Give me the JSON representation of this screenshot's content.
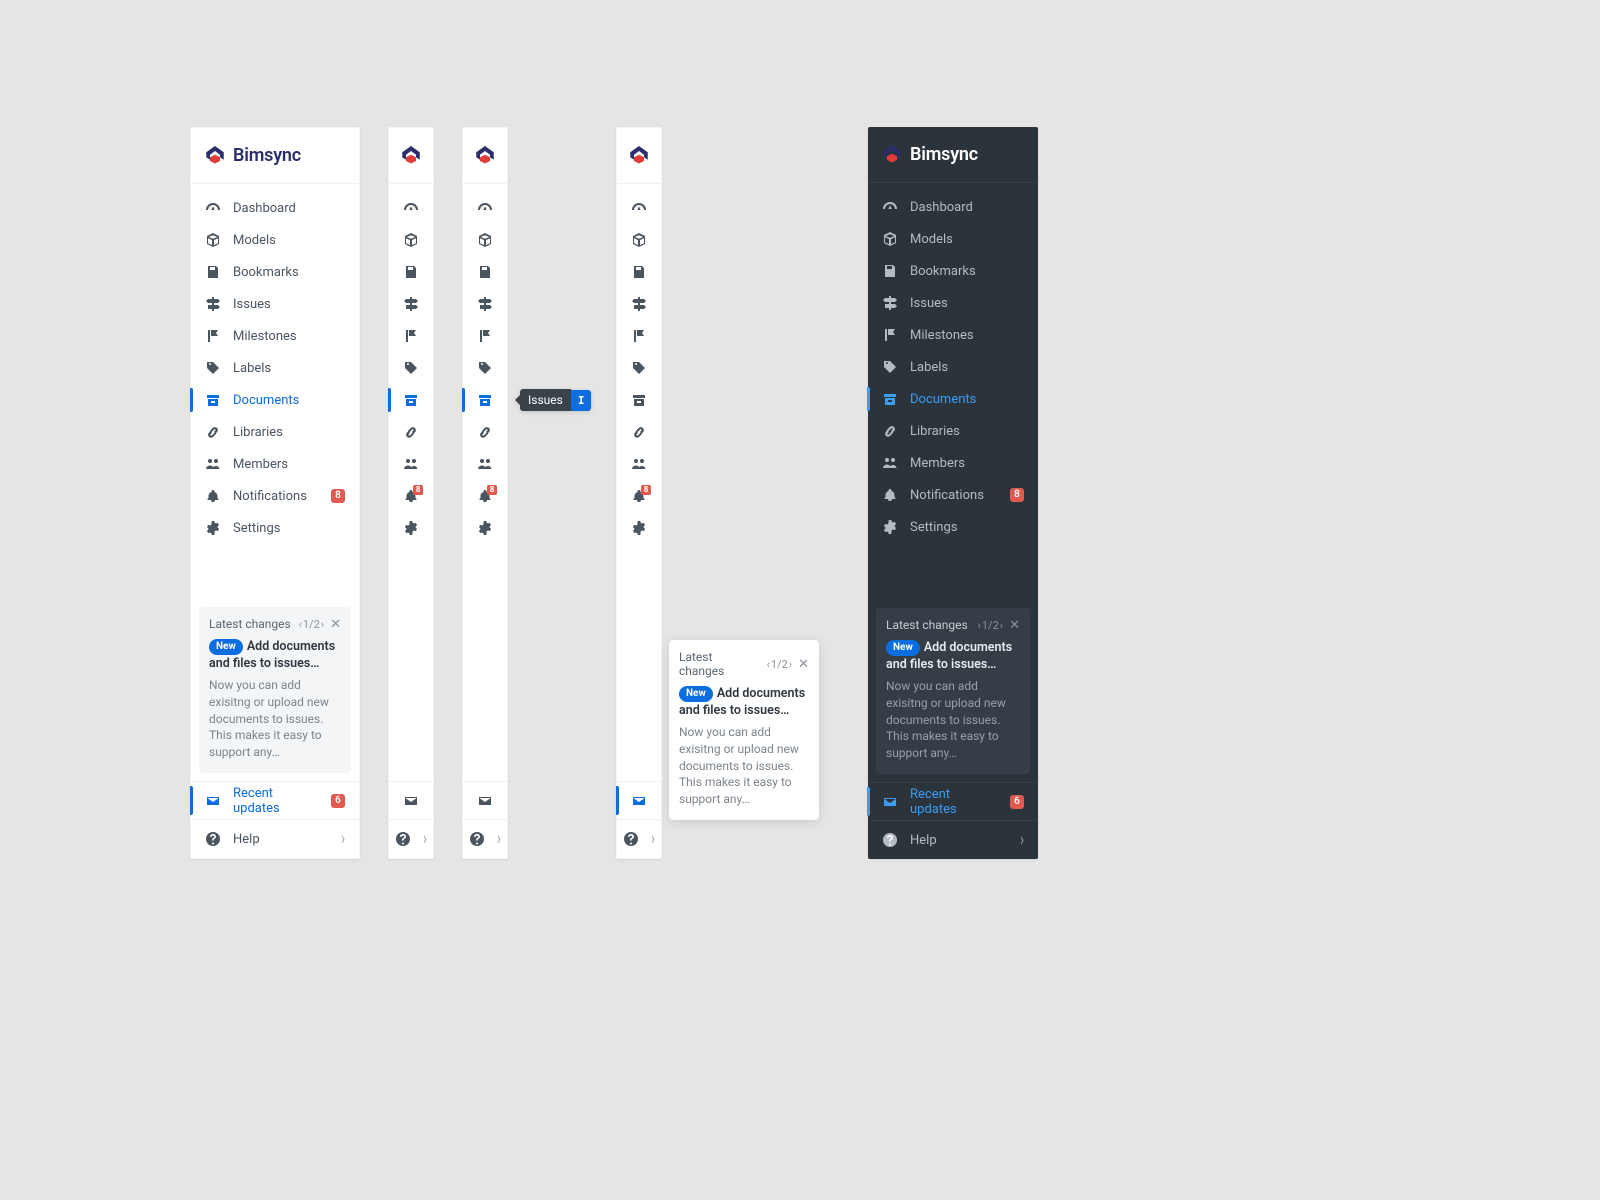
{
  "brand": {
    "name": "Bimsync"
  },
  "nav": {
    "items": [
      {
        "key": "dashboard",
        "label": "Dashboard",
        "icon": "gauge-icon"
      },
      {
        "key": "models",
        "label": "Models",
        "icon": "cube-icon"
      },
      {
        "key": "bookmarks",
        "label": "Bookmarks",
        "icon": "save-icon"
      },
      {
        "key": "issues",
        "label": "Issues",
        "icon": "signpost-icon"
      },
      {
        "key": "milestones",
        "label": "Milestones",
        "icon": "flag-icon"
      },
      {
        "key": "labels",
        "label": "Labels",
        "icon": "tag-icon"
      },
      {
        "key": "documents",
        "label": "Documents",
        "icon": "archive-icon",
        "active": true
      },
      {
        "key": "libraries",
        "label": "Libraries",
        "icon": "link-icon"
      },
      {
        "key": "members",
        "label": "Members",
        "icon": "group-icon"
      },
      {
        "key": "notifications",
        "label": "Notifications",
        "icon": "bell-icon",
        "badge": "8"
      },
      {
        "key": "settings",
        "label": "Settings",
        "icon": "gear-icon"
      }
    ]
  },
  "tooltip": {
    "label": "Issues",
    "key": "I"
  },
  "changes": {
    "title": "Latest changes",
    "pager_prev": "‹",
    "pager_text": "1/2",
    "pager_next": "›",
    "pill": "New",
    "headline": "Add documents and files to issues…",
    "body": "Now you can add exisitng or upload new documents to issues. This makes it easy to support any…"
  },
  "footer": {
    "recent_label": "Recent updates",
    "recent_badge": "6",
    "help_label": "Help"
  }
}
